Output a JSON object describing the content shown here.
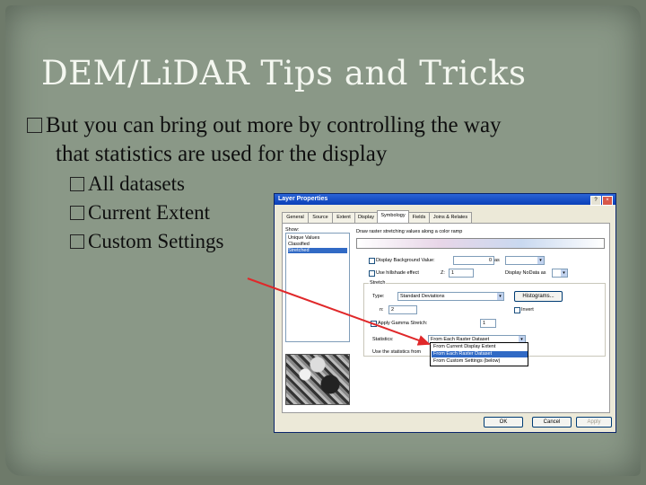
{
  "slide": {
    "title": "DEM/LiDAR Tips and Tricks",
    "bullet_glyph": "�",
    "main_bullet": {
      "line1": "But you can bring out more by controlling the way",
      "line2": "that statistics are used for the display"
    },
    "sub_bullets": [
      "All datasets",
      "Current Extent",
      "Custom Settings"
    ]
  },
  "dialog": {
    "title": "Layer Properties",
    "help_button": "?",
    "close_button": "×",
    "tabs": [
      "General",
      "Source",
      "Extent",
      "Display",
      "Symbology",
      "Fields",
      "Joins & Relates"
    ],
    "active_tab": "Symbology",
    "show_label": "Show:",
    "show_items": [
      "Unique Values",
      "Classified",
      "Stretched"
    ],
    "selected_show_item": "Stretched",
    "draw_text": "Draw raster stretching values along a color ramp",
    "display_background": {
      "label": "Display Background Value:",
      "value": "0",
      "as_label": "as"
    },
    "hillshade": {
      "label": "Use hillshade effect",
      "z_label": "Z:",
      "z_value": "1"
    },
    "nodata_label": "Display NoData as",
    "stretch_label": "Stretch",
    "type": {
      "label": "Type:",
      "value": "Standard Deviations"
    },
    "histograms_button": "Histograms...",
    "n_label": "n:",
    "n_value": "2",
    "invert_label": "Invert",
    "apply_gamma": {
      "label": "Apply Gamma Stretch:",
      "value": "1"
    },
    "statistics_label": "Statistics:",
    "statistics_value": "From Each Raster Dataset",
    "use_stats_label": "Use the statistics from",
    "statistics_options": [
      "From Current Display Extent",
      "From Each Raster Dataset",
      "From Custom Settings (below)"
    ],
    "highlighted_option": "From Each Raster Dataset",
    "ok_button": "OK",
    "cancel_button": "Cancel",
    "apply_button": "Apply"
  },
  "colors": {
    "arrow": "#e0282a",
    "title_text": "#f4f7f0",
    "background": "#8a9887",
    "selection": "#316ac5"
  }
}
